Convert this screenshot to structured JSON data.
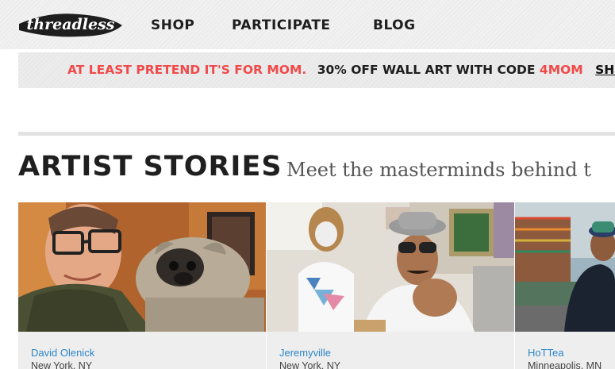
{
  "header": {
    "logo_text": "threadless",
    "nav": [
      "SHOP",
      "PARTICIPATE",
      "BLOG"
    ]
  },
  "promo": {
    "highlight": "AT LEAST PRETEND IT'S FOR MOM.",
    "text": "30% OFF WALL ART WITH CODE",
    "code": "4MOM",
    "link": "SHOP"
  },
  "section": {
    "title": "ARTIST STORIES",
    "subtitle": "Meet the masterminds behind t"
  },
  "cards": [
    {
      "name": "David Olenick",
      "location": "New York, NY"
    },
    {
      "name": "Jeremyville",
      "location": "New York, NY"
    },
    {
      "name": "HoTTea",
      "location": "Minneapolis, MN"
    }
  ],
  "colors": {
    "accent_red": "#f04a4a",
    "link_blue": "#2b86c9",
    "text_dark": "#1e1e1e"
  }
}
